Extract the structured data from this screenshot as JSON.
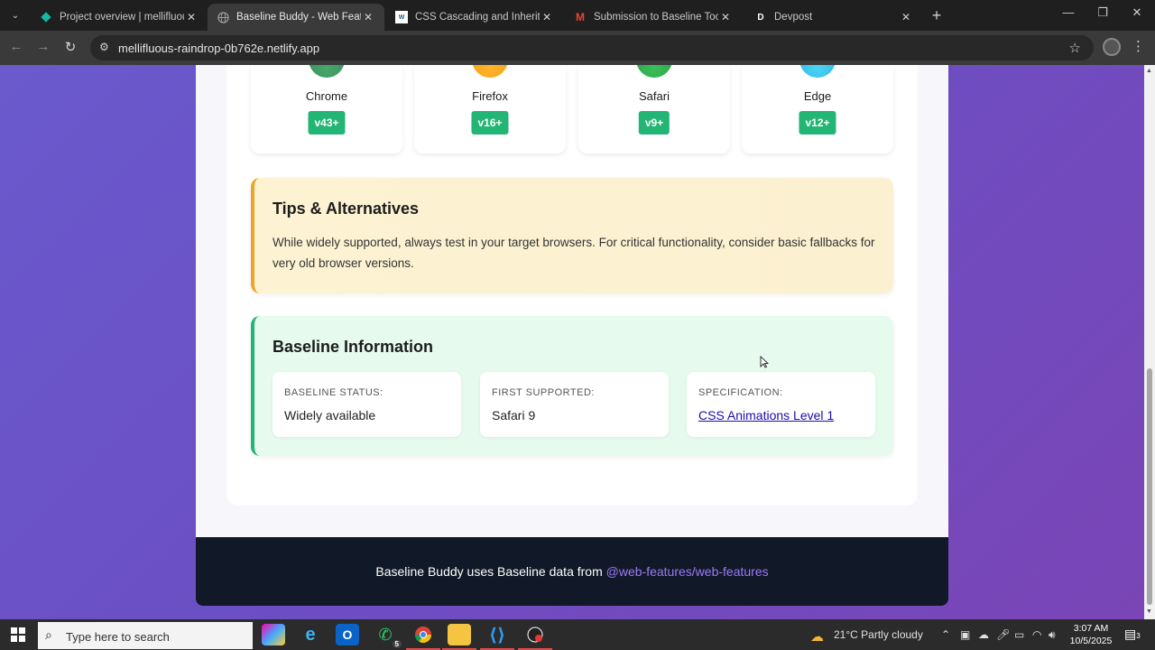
{
  "browser": {
    "tabs": [
      {
        "title": "Project overview | mellifluous-r",
        "favicon": "netlify-icon",
        "color": "#14b8a6"
      },
      {
        "title": "Baseline Buddy - Web Feature C",
        "favicon": "globe-icon",
        "color": "#9aa0a6"
      },
      {
        "title": "CSS Cascading and Inheritance",
        "favicon": "w3c-icon",
        "color": "#ffffff"
      },
      {
        "title": "Submission to Baseline Tooling",
        "favicon": "gmail-icon",
        "color": "#ea4335"
      },
      {
        "title": "Devpost",
        "favicon": "devpost-icon",
        "color": "#ffffff"
      }
    ],
    "url": "mellifluous-raindrop-0b762e.netlify.app"
  },
  "browsers": [
    {
      "name": "Chrome",
      "version": "v43+",
      "color": "#3aa35a"
    },
    {
      "name": "Firefox",
      "version": "v16+",
      "color": "#f5a623"
    },
    {
      "name": "Safari",
      "version": "v9+",
      "color": "#2fb34a"
    },
    {
      "name": "Edge",
      "version": "v12+",
      "color": "#38bdf8"
    }
  ],
  "tips": {
    "title": "Tips & Alternatives",
    "body": "While widely supported, always test in your target browsers. For critical functionality, consider basic fallbacks for very old browser versions."
  },
  "baseline": {
    "title": "Baseline Information",
    "items": [
      {
        "label": "BASELINE STATUS:",
        "value": "Widely available"
      },
      {
        "label": "FIRST SUPPORTED:",
        "value": "Safari 9"
      },
      {
        "label": "SPECIFICATION:",
        "value": "CSS Animations Level 1"
      }
    ]
  },
  "footer": {
    "text": "Baseline Buddy uses Baseline data from",
    "link": "@web-features/web-features"
  },
  "taskbar": {
    "search_placeholder": "Type here to search",
    "whatsapp_badge": "5",
    "weather": "21°C  Partly cloudy",
    "time": "3:07 AM",
    "date": "10/5/2025",
    "notifications": "3"
  }
}
